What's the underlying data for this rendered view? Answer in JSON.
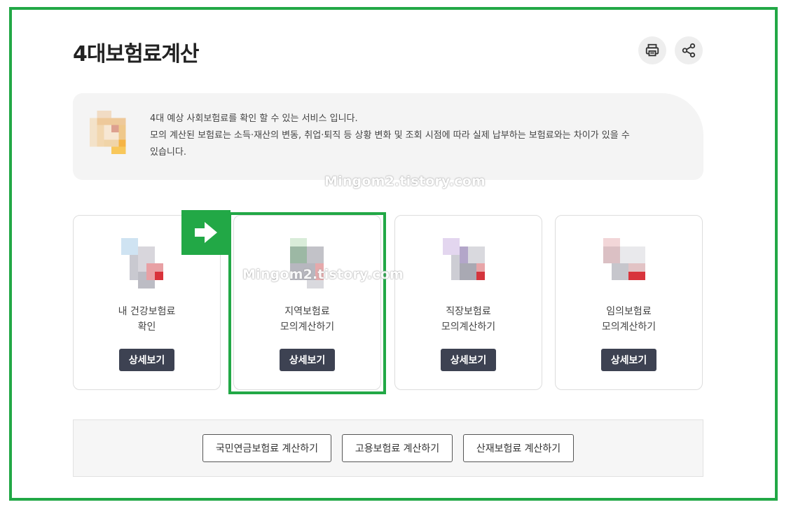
{
  "page": {
    "title": "4대보험료계산"
  },
  "header_actions": {
    "print_icon": "printer-icon",
    "share_icon": "share-icon"
  },
  "notice": {
    "line1": "4대 예상 사회보험료를 확인 할 수 있는 서비스 입니다.",
    "line2": "모의 계산된 보험료는 소득·재산의 변동, 취업·퇴직 등 상황 변화 및 조회 시점에 따라 실제 납부하는 보험료와는 차이가 있을 수",
    "line3": "있습니다."
  },
  "watermark": "Mingom2.tistory.com",
  "cards": [
    {
      "line1": "내 건강보험료",
      "line2": "확인",
      "button": "상세보기"
    },
    {
      "line1": "지역보험료",
      "line2": "모의계산하기",
      "button": "상세보기"
    },
    {
      "line1": "직장보험료",
      "line2": "모의계산하기",
      "button": "상세보기"
    },
    {
      "line1": "임의보험료",
      "line2": "모의계산하기",
      "button": "상세보기"
    }
  ],
  "bottom_buttons": [
    "국민연금보험료 계산하기",
    "고용보험료 계산하기",
    "산재보험료 계산하기"
  ],
  "colors": {
    "highlight": "#22a846",
    "button_dark": "#3d4252"
  }
}
